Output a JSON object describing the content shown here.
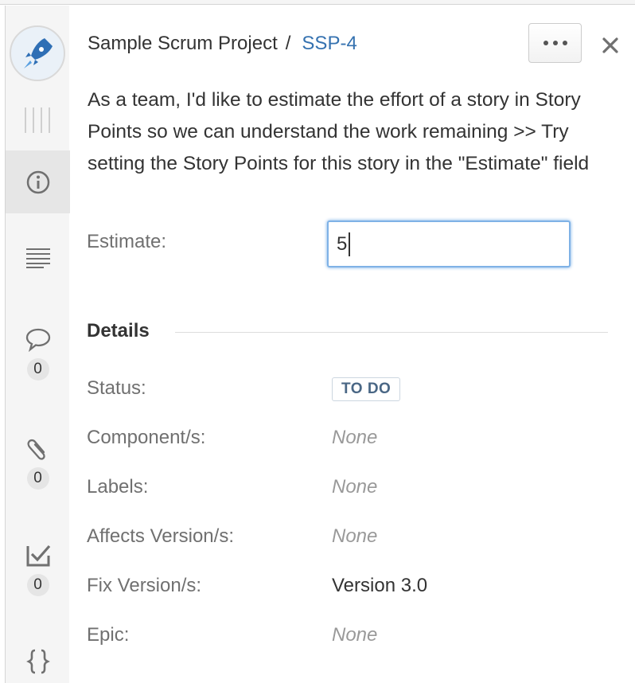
{
  "header": {
    "project_name": "Sample Scrum Project",
    "separator": "/",
    "issue_key": "SSP-4"
  },
  "summary": "As a team, I'd like to estimate the effort of a story in Story Points so we can understand the work remaining >> Try setting the Story Points for this story in the \"Estimate\" field",
  "estimate": {
    "label": "Estimate:",
    "value": "5"
  },
  "details": {
    "title": "Details",
    "status": {
      "label": "Status:",
      "value": "TO DO"
    },
    "components": {
      "label": "Component/s:",
      "value": "None"
    },
    "labels": {
      "label": "Labels:",
      "value": "None"
    },
    "affects_versions": {
      "label": "Affects Version/s:",
      "value": "None"
    },
    "fix_versions": {
      "label": "Fix Version/s:",
      "value": "Version 3.0"
    },
    "epic": {
      "label": "Epic:",
      "value": "None"
    }
  },
  "rail": {
    "items": [
      {
        "icon": "info-icon",
        "active": true
      },
      {
        "icon": "description-icon"
      },
      {
        "icon": "comment-icon",
        "count": "0"
      },
      {
        "icon": "attachment-icon",
        "count": "0"
      },
      {
        "icon": "subtask-icon",
        "count": "0"
      },
      {
        "icon": "code-braces-icon"
      }
    ]
  },
  "colors": {
    "link": "#3572b0",
    "status_text": "#4a6785",
    "label_gray": "#707070",
    "rail_bg": "#f5f5f5"
  }
}
